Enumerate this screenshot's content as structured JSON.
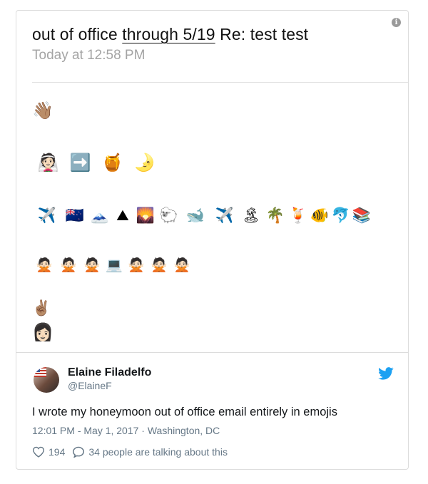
{
  "email": {
    "subject_prefix": "out of office ",
    "subject_underlined": "through 5/19",
    "subject_suffix": " Re: test test",
    "date": "Today at 12:58 PM",
    "info_icon": "i",
    "rows": [
      [
        "👋🏽"
      ],
      [
        "👰🏻",
        "➡️",
        "🍯",
        "🌛"
      ],
      [
        "✈️",
        "🇳🇿",
        "🗻",
        "⛰",
        "🌄",
        "🐑",
        "🐋",
        "✈️",
        "🏝",
        "🌴",
        "🍹",
        "🐠",
        "🐬",
        "📚"
      ],
      [
        "🙅🏻",
        "🙅🏻",
        "🙅🏻",
        "💻",
        "🙅🏻",
        "🙅🏻",
        "🙅🏻"
      ],
      [
        "✌🏽"
      ],
      [
        "👩🏻"
      ]
    ]
  },
  "tweet": {
    "name": "Elaine Filadelfo",
    "handle": "@ElaineF",
    "text": "I wrote my honeymoon out of office email entirely in emojis",
    "meta": "12:01 PM - May 1, 2017 · Washington, DC",
    "likes": "194",
    "replies_text": "34 people are talking about this",
    "brand_color": "#1da1f2",
    "icons": {
      "bird": "twitter-bird-icon",
      "heart": "heart-icon",
      "reply": "reply-bubble-icon"
    }
  }
}
